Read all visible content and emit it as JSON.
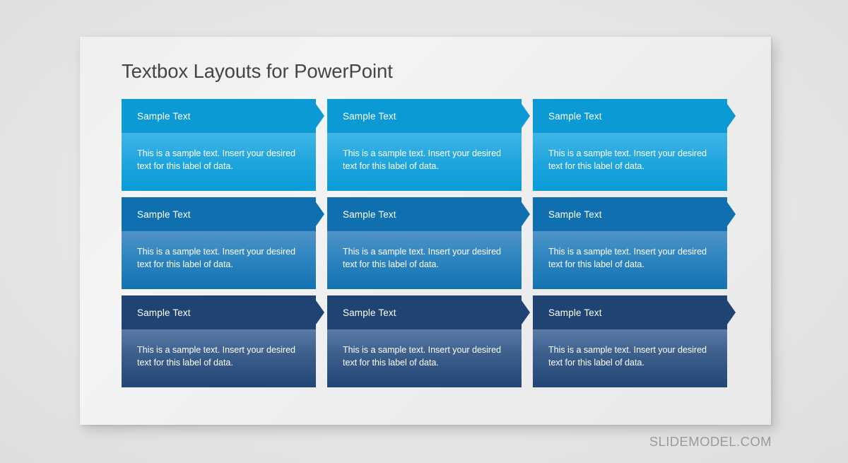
{
  "slide": {
    "title": "Textbox Layouts for PowerPoint",
    "watermark": "SLIDEMODEL.COM"
  },
  "colors": {
    "page_background": "#e8e8e8",
    "slide_background": "#f2f2f2",
    "title_text": "#454545",
    "watermark_text": "#9a9a9a",
    "row1_header": "#0c9ad6",
    "row1_body_top": "#41b5e6",
    "row1_body_bottom": "#079cd8",
    "row2_header": "#1070af",
    "row2_body_top": "#4f94c8",
    "row2_body_bottom": "#1272b0",
    "row3_header": "#1f4372",
    "row3_body_top": "#5b7ba6",
    "row3_body_bottom": "#224675",
    "card_text": "#ffffff"
  },
  "rows": [
    {
      "tone": "azure",
      "cards": [
        {
          "title": "Sample  Text",
          "text": "This is a sample text. Insert your desired text for this label of data."
        },
        {
          "title": "Sample  Text",
          "text": "This is a sample text. Insert your desired text for this label of data."
        },
        {
          "title": "Sample  Text",
          "text": "This is a sample text. Insert your desired text for this label of data."
        }
      ]
    },
    {
      "tone": "medium-blue",
      "cards": [
        {
          "title": "Sample  Text",
          "text": "This is a sample text. Insert your desired text for this label of data."
        },
        {
          "title": "Sample  Text",
          "text": "This is a sample text. Insert your desired text for this label of data."
        },
        {
          "title": "Sample  Text",
          "text": "This is a sample text. Insert your desired text for this label of data."
        }
      ]
    },
    {
      "tone": "dark-navy",
      "cards": [
        {
          "title": "Sample  Text",
          "text": "This is a sample text. Insert your desired text for this label of data."
        },
        {
          "title": "Sample  Text",
          "text": "This is a sample text. Insert your desired text for this label of data."
        },
        {
          "title": "Sample  Text",
          "text": "This is a sample text. Insert your desired text for this label of data."
        }
      ]
    }
  ]
}
